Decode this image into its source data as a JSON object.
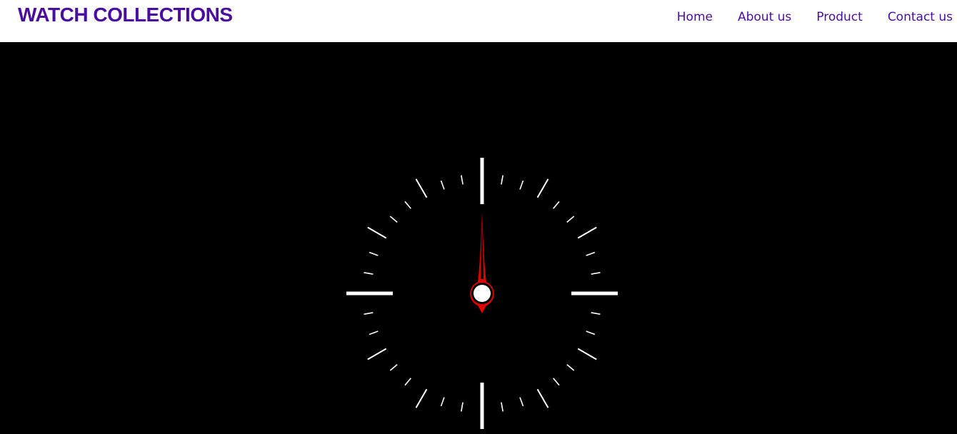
{
  "header": {
    "brand": "WATCH COLLECTIONS",
    "nav": [
      {
        "label": "Home"
      },
      {
        "label": "About us"
      },
      {
        "label": "Product"
      },
      {
        "label": "Contact us"
      }
    ]
  },
  "colors": {
    "brand": "#4a0e9e",
    "nav_link": "#4a0e9e",
    "header_bg": "#ffffff",
    "hero_bg": "#000000",
    "tick": "#ffffff",
    "second_hand": "#e00000"
  },
  "clock": {
    "time": {
      "hours": 12,
      "minutes": 0,
      "seconds": 0
    },
    "icons": {
      "dial": "clock-dial-icon",
      "hand": "second-hand-icon"
    }
  }
}
